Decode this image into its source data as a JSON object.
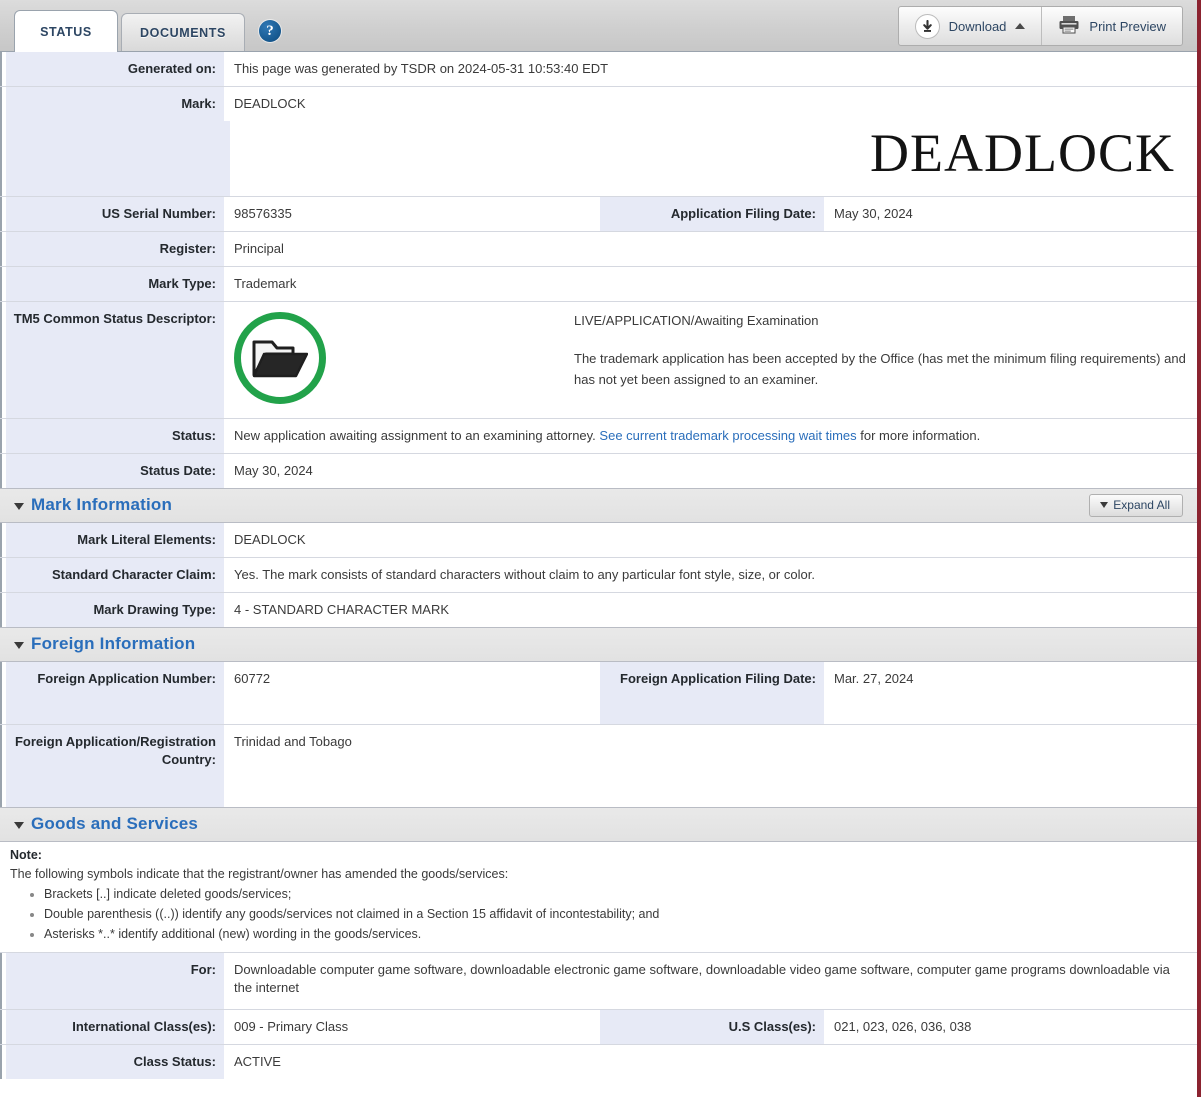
{
  "tabs": [
    {
      "label": "STATUS",
      "name": "tab-status",
      "active": true
    },
    {
      "label": "DOCUMENTS",
      "name": "tab-documents",
      "active": false
    }
  ],
  "help_icon_glyph": "?",
  "toolbar": {
    "download_label": "Download",
    "download_icon": "download-arrow-icon",
    "download_caret": "caret-up-icon",
    "print_preview_label": "Print Preview",
    "print_icon": "printer-icon"
  },
  "colors": {
    "accent_blue": "#2a6ebb",
    "label_bg": "#e7eaf6",
    "status_green": "#22a24a",
    "right_border": "#8b2330"
  },
  "top_fields": {
    "generated_on_label": "Generated on:",
    "generated_on_value": "This page was generated by TSDR on 2024-05-31 10:53:40 EDT",
    "mark_label": "Mark:",
    "mark_value": "DEADLOCK",
    "mark_display": "DEADLOCK",
    "us_serial_number_label": "US Serial Number:",
    "us_serial_number_value": "98576335",
    "application_filing_date_label": "Application Filing Date:",
    "application_filing_date_value": "May 30, 2024",
    "register_label": "Register:",
    "register_value": "Principal",
    "mark_type_label": "Mark Type:",
    "mark_type_value": "Trademark",
    "tm5_label": "TM5 Common Status Descriptor:",
    "tm5_icon": "open-folder-icon",
    "tm5_headline": "LIVE/APPLICATION/Awaiting Examination",
    "tm5_description": "The trademark application has been accepted by the Office (has met the minimum filing requirements) and has not yet been assigned to an examiner.",
    "status_label": "Status:",
    "status_value_pre": "New application awaiting assignment to an examining attorney. ",
    "status_link_text": "See current trademark processing wait times",
    "status_value_post": " for more information.",
    "status_date_label": "Status Date:",
    "status_date_value": "May 30, 2024"
  },
  "mark_information": {
    "section_title": "Mark Information",
    "expand_all_label": "Expand All",
    "mark_literal_elements_label": "Mark Literal Elements:",
    "mark_literal_elements_value": "DEADLOCK",
    "standard_character_claim_label": "Standard Character Claim:",
    "standard_character_claim_value": "Yes. The mark consists of standard characters without claim to any particular font style, size, or color.",
    "mark_drawing_type_label": "Mark Drawing Type:",
    "mark_drawing_type_value": "4 - STANDARD CHARACTER MARK"
  },
  "foreign_information": {
    "section_title": "Foreign Information",
    "foreign_application_number_label": "Foreign Application Number:",
    "foreign_application_number_value": "60772",
    "foreign_application_filing_date_label": "Foreign Application Filing Date:",
    "foreign_application_filing_date_value": "Mar. 27, 2024",
    "foreign_country_label": "Foreign Application/Registration Country:",
    "foreign_country_value": "Trinidad and Tobago"
  },
  "goods_and_services": {
    "section_title": "Goods and Services",
    "note_title": "Note:",
    "note_lead": "The following symbols indicate that the registrant/owner has amended the goods/services:",
    "note_bullets": [
      "Brackets [..] indicate deleted goods/services;",
      "Double parenthesis ((..)) identify any goods/services not claimed in a Section 15 affidavit of incontestability; and",
      "Asterisks *..* identify additional (new) wording in the goods/services."
    ],
    "for_label": "For:",
    "for_value": "Downloadable computer game software, downloadable electronic game software, downloadable video game software, computer game programs downloadable via the internet",
    "international_class_label": "International Class(es):",
    "international_class_value": "009 - Primary Class",
    "us_class_label": "U.S Class(es):",
    "us_class_value": "021, 023, 026, 036, 038",
    "class_status_label": "Class Status:",
    "class_status_value": "ACTIVE"
  }
}
